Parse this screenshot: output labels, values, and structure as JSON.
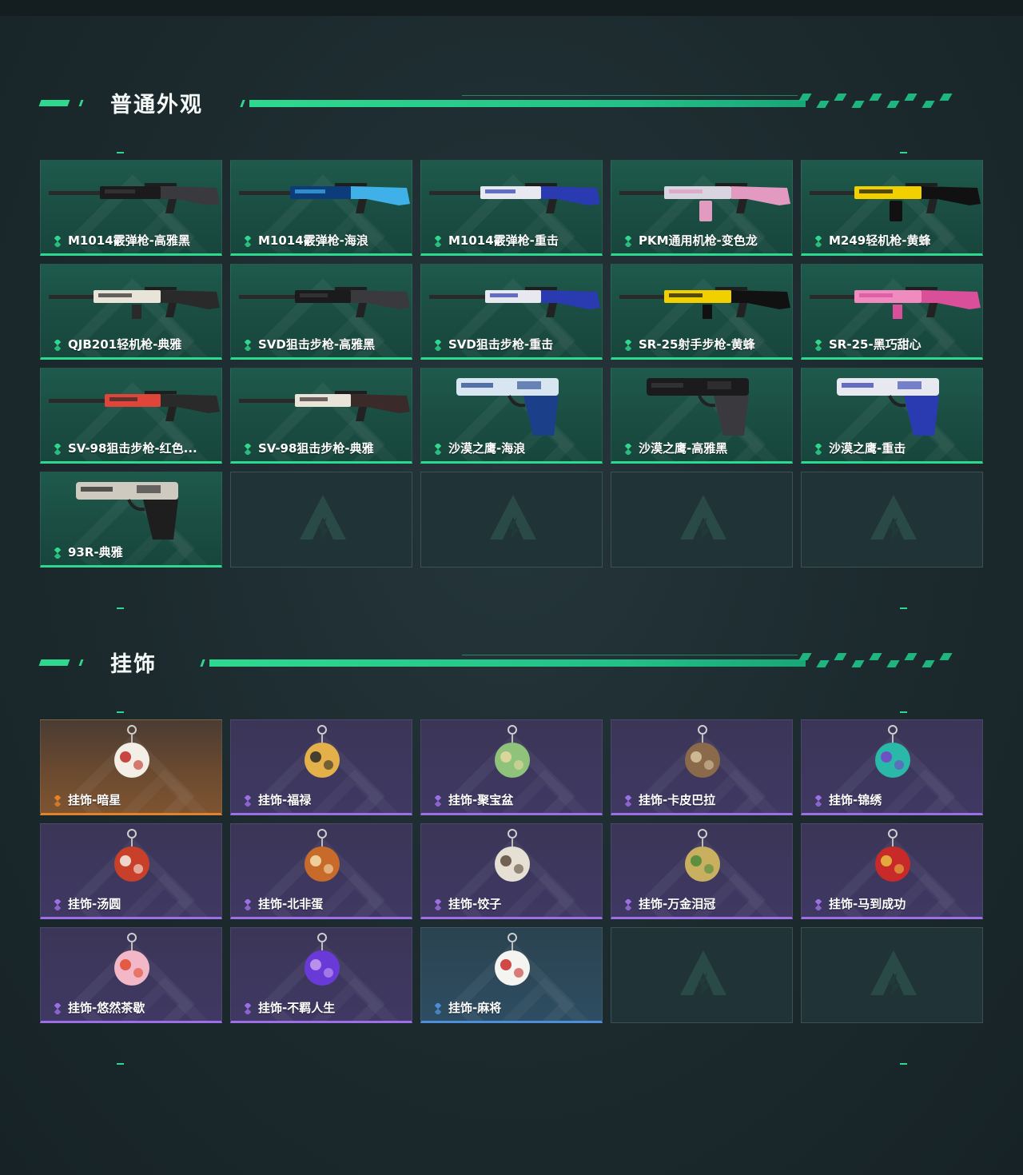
{
  "sections": [
    {
      "title": "普通外观",
      "items": [
        {
          "label": "M1014霰弹枪-高雅黑",
          "rarity": "green",
          "icon": "shotgun-icon",
          "c1": "#1b1b1d",
          "c2": "#3a3a3e"
        },
        {
          "label": "M1014霰弹枪-海浪",
          "rarity": "green",
          "icon": "shotgun-icon",
          "c1": "#0d3c7a",
          "c2": "#3fb1e8"
        },
        {
          "label": "M1014霰弹枪-重击",
          "rarity": "green",
          "icon": "shotgun-icon",
          "c1": "#e8e8f0",
          "c2": "#2a3ab0"
        },
        {
          "label": "PKM通用机枪-变色龙",
          "rarity": "green",
          "icon": "machine-gun-icon",
          "c1": "#d8d4e0",
          "c2": "#e29ac0"
        },
        {
          "label": "M249轻机枪-黄蜂",
          "rarity": "green",
          "icon": "machine-gun-icon",
          "c1": "#f2d000",
          "c2": "#111111"
        },
        {
          "label": "QJB201轻机枪-典雅",
          "rarity": "green",
          "icon": "rifle-icon",
          "c1": "#e8e4d8",
          "c2": "#2a2a2a"
        },
        {
          "label": "SVD狙击步枪-高雅黑",
          "rarity": "green",
          "icon": "sniper-rifle-icon",
          "c1": "#1b1b1d",
          "c2": "#3a3a3e"
        },
        {
          "label": "SVD狙击步枪-重击",
          "rarity": "green",
          "icon": "sniper-rifle-icon",
          "c1": "#e8e8f0",
          "c2": "#2a3ab0"
        },
        {
          "label": "SR-25射手步枪-黄蜂",
          "rarity": "green",
          "icon": "rifle-icon",
          "c1": "#f2d000",
          "c2": "#111111"
        },
        {
          "label": "SR-25-黑巧甜心",
          "rarity": "green",
          "icon": "rifle-icon",
          "c1": "#f08bc0",
          "c2": "#d94f9a"
        },
        {
          "label": "SV-98狙击步枪-红色...",
          "rarity": "green",
          "icon": "sniper-rifle-icon",
          "c1": "#e0453a",
          "c2": "#2a2a2a"
        },
        {
          "label": "SV-98狙击步枪-典雅",
          "rarity": "green",
          "icon": "sniper-rifle-icon",
          "c1": "#e8e4d8",
          "c2": "#3a2a2a"
        },
        {
          "label": "沙漠之鹰-海浪",
          "rarity": "green",
          "icon": "pistol-icon",
          "c1": "#d8e6f2",
          "c2": "#1c3f8a"
        },
        {
          "label": "沙漠之鹰-高雅黑",
          "rarity": "green",
          "icon": "pistol-icon",
          "c1": "#1b1b1d",
          "c2": "#3a3a3e"
        },
        {
          "label": "沙漠之鹰-重击",
          "rarity": "green",
          "icon": "pistol-icon",
          "c1": "#e8e8f0",
          "c2": "#2a3ab0"
        },
        {
          "label": "93R-典雅",
          "rarity": "green",
          "icon": "pistol-icon",
          "c1": "#cfcac0",
          "c2": "#1e1e1e"
        },
        {
          "empty": true
        },
        {
          "empty": true
        },
        {
          "empty": true
        },
        {
          "empty": true
        }
      ]
    },
    {
      "title": "挂饰",
      "items": [
        {
          "label": "挂饰-暗星",
          "rarity": "gold",
          "icon": "feather-charm-icon",
          "c1": "#f4efe6",
          "c2": "#c0281e"
        },
        {
          "label": "挂饰-福禄",
          "rarity": "purple",
          "icon": "gourd-charm-icon",
          "c1": "#e3b04a",
          "c2": "#2a2a2a"
        },
        {
          "label": "挂饰-聚宝盆",
          "rarity": "purple",
          "icon": "treasure-bowl-charm-icon",
          "c1": "#8fc27a",
          "c2": "#e8d8a0"
        },
        {
          "label": "挂饰-卡皮巴拉",
          "rarity": "purple",
          "icon": "capybara-charm-icon",
          "c1": "#8a6a4a",
          "c2": "#d9c4a0"
        },
        {
          "label": "挂饰-锦绣",
          "rarity": "purple",
          "icon": "butterfly-charm-icon",
          "c1": "#2ab8a8",
          "c2": "#7a3fc8"
        },
        {
          "label": "挂饰-汤圆",
          "rarity": "purple",
          "icon": "tangyuan-charm-icon",
          "c1": "#c8402a",
          "c2": "#f4efe6"
        },
        {
          "label": "挂饰-北非蛋",
          "rarity": "purple",
          "icon": "shakshuka-charm-icon",
          "c1": "#c86a2a",
          "c2": "#f4e0b0"
        },
        {
          "label": "挂饰-饺子",
          "rarity": "purple",
          "icon": "dumpling-charm-icon",
          "c1": "#e6e0d4",
          "c2": "#5a4a3a"
        },
        {
          "label": "挂饰-万金泪冠",
          "rarity": "purple",
          "icon": "crown-charm-icon",
          "c1": "#c8b060",
          "c2": "#4a8a3a"
        },
        {
          "label": "挂饰-马到成功",
          "rarity": "purple",
          "icon": "horse-charm-icon",
          "c1": "#c82a2a",
          "c2": "#e8c040"
        },
        {
          "label": "挂饰-悠然茶歇",
          "rarity": "purple",
          "icon": "cupcake-charm-icon",
          "c1": "#f2b8c8",
          "c2": "#e04a2a"
        },
        {
          "label": "挂饰-不羁人生",
          "rarity": "purple",
          "icon": "sneaker-charm-icon",
          "c1": "#6a3ad8",
          "c2": "#c8a0f0"
        },
        {
          "label": "挂饰-麻将",
          "rarity": "blue",
          "icon": "mahjong-charm-icon",
          "c1": "#f4f4f0",
          "c2": "#c82a2a"
        },
        {
          "empty": true
        },
        {
          "empty": true
        }
      ]
    }
  ],
  "colors": {
    "accent": "#2fd88f",
    "green": "#2fd88f",
    "gold": "#e2822b",
    "purple": "#9d6fe6",
    "blue": "#4c8fd8"
  }
}
